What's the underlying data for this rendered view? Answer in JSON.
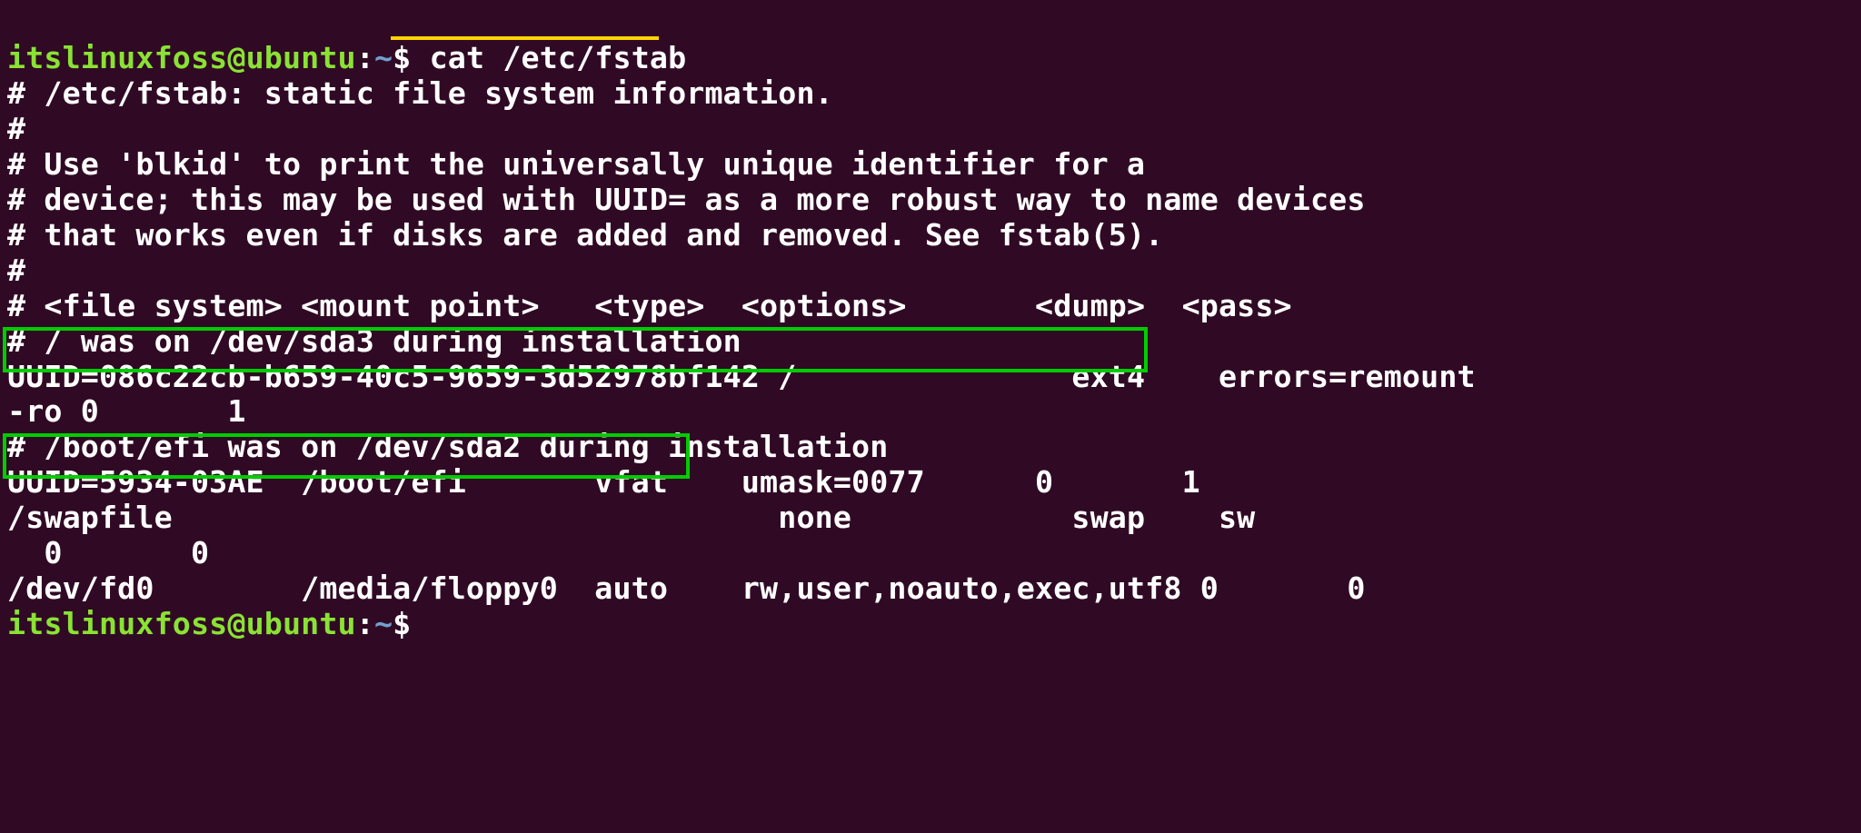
{
  "prompt": {
    "user": "itslinuxfoss",
    "at": "@",
    "host": "ubuntu",
    "colon": ":",
    "path": "~",
    "dollar": "$ "
  },
  "command": "cat /etc/fstab",
  "lines": {
    "l1": "# /etc/fstab: static file system information.",
    "l2": "#",
    "l3": "# Use 'blkid' to print the universally unique identifier for a",
    "l4": "# device; this may be used with UUID= as a more robust way to name devices",
    "l5": "# that works even if disks are added and removed. See fstab(5).",
    "l6": "#",
    "l7": "# <file system> <mount point>   <type>  <options>       <dump>  <pass>",
    "l8": "# / was on /dev/sda3 during installation",
    "l9a": "UUID=086c22cb-b659-40c5-9659-3d52978bf142 /               ext4",
    "l9b": "    errors=remount",
    "l10": "-ro 0       1",
    "l11": "# /boot/efi was on /dev/sda2 during installation",
    "l12a": "UUID=5934-03AE  /boot/efi       vfat",
    "l12b": "    umask=0077      0       1",
    "l13": "/swapfile                                 none            swap    sw    ",
    "l14": "  0       0",
    "l15": "/dev/fd0        /media/floppy0  auto    rw,user,noauto,exec,utf8 0       0"
  },
  "fstab_entries": [
    {
      "file_system": "UUID=086c22cb-b659-40c5-9659-3d52978bf142",
      "mount_point": "/",
      "type": "ext4",
      "options": "errors=remount-ro",
      "dump": "0",
      "pass": "1"
    },
    {
      "file_system": "UUID=5934-03AE",
      "mount_point": "/boot/efi",
      "type": "vfat",
      "options": "umask=0077",
      "dump": "0",
      "pass": "1"
    },
    {
      "file_system": "/swapfile",
      "mount_point": "none",
      "type": "swap",
      "options": "sw",
      "dump": "0",
      "pass": "0"
    },
    {
      "file_system": "/dev/fd0",
      "mount_point": "/media/floppy0",
      "type": "auto",
      "options": "rw,user,noauto,exec,utf8",
      "dump": "0",
      "pass": "0"
    }
  ]
}
